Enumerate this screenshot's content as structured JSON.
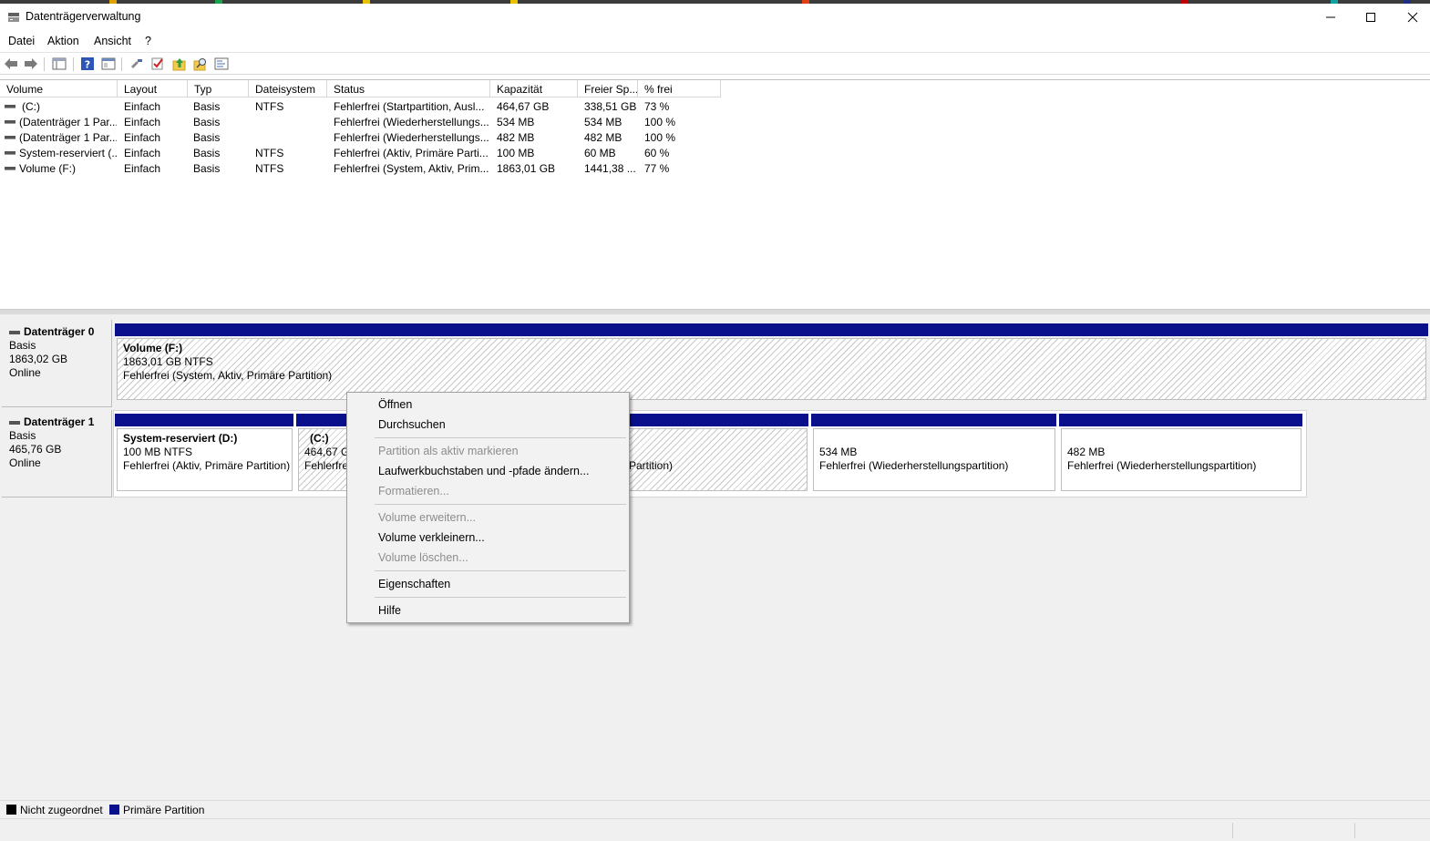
{
  "window": {
    "title": "Datenträgerverwaltung",
    "minimize_label": "Minimieren",
    "maximize_label": "Maximieren",
    "close_label": "Schließen"
  },
  "menubar": {
    "items": [
      {
        "label": "Datei"
      },
      {
        "label": "Aktion"
      },
      {
        "label": "Ansicht"
      },
      {
        "label": "?"
      }
    ]
  },
  "toolbar": {
    "icons": [
      "back-arrow-icon",
      "forward-arrow-icon",
      "volume-list-icon",
      "help-icon",
      "console-view-icon",
      "connect-icon",
      "check-icon",
      "folder-up-icon",
      "search-folder-icon",
      "properties-icon"
    ]
  },
  "volume_list": {
    "columns": [
      "Volume",
      "Layout",
      "Typ",
      "Dateisystem",
      "Status",
      "Kapazität",
      "Freier Sp...",
      "% frei"
    ],
    "rows": [
      {
        "volume": "(C:)",
        "layout": "Einfach",
        "typ": "Basis",
        "fs": "NTFS",
        "status": "Fehlerfrei (Startpartition, Ausl...",
        "capacity": "464,67 GB",
        "free": "338,51 GB",
        "pct": "73 %"
      },
      {
        "volume": "(Datenträger 1 Par...",
        "layout": "Einfach",
        "typ": "Basis",
        "fs": "",
        "status": "Fehlerfrei (Wiederherstellungs...",
        "capacity": "534 MB",
        "free": "534 MB",
        "pct": "100 %"
      },
      {
        "volume": "(Datenträger 1 Par...",
        "layout": "Einfach",
        "typ": "Basis",
        "fs": "",
        "status": "Fehlerfrei (Wiederherstellungs...",
        "capacity": "482 MB",
        "free": "482 MB",
        "pct": "100 %"
      },
      {
        "volume": "System-reserviert (...",
        "layout": "Einfach",
        "typ": "Basis",
        "fs": "NTFS",
        "status": "Fehlerfrei (Aktiv, Primäre Parti...",
        "capacity": "100 MB",
        "free": "60 MB",
        "pct": "60 %"
      },
      {
        "volume": "Volume (F:)",
        "layout": "Einfach",
        "typ": "Basis",
        "fs": "NTFS",
        "status": "Fehlerfrei (System, Aktiv, Prim...",
        "capacity": "1863,01 GB",
        "free": "1441,38 ...",
        "pct": "77 %"
      }
    ]
  },
  "disks": [
    {
      "name": "Datenträger 0",
      "type": "Basis",
      "size": "1863,02 GB",
      "state": "Online",
      "partitions": [
        {
          "name": "Volume  (F:)",
          "size_fs": "1863,01 GB NTFS",
          "status": "Fehlerfrei (System, Aktiv, Primäre Partition)"
        }
      ]
    },
    {
      "name": "Datenträger 1",
      "type": "Basis",
      "size": "465,76 GB",
      "state": "Online",
      "partitions": [
        {
          "name": "System-reserviert  (D:)",
          "size_fs": "100 MB NTFS",
          "status": "Fehlerfrei (Aktiv, Primäre Partition)"
        },
        {
          "name": "(C:)",
          "size_fs": "464,67 GB",
          "status": "Fehlerfrei",
          "status_tail": "Partition)"
        },
        {
          "name": "",
          "size_fs": "534 MB",
          "status": "Fehlerfrei (Wiederherstellungspartition)"
        },
        {
          "name": "",
          "size_fs": "482 MB",
          "status": "Fehlerfrei (Wiederherstellungspartition)"
        }
      ]
    }
  ],
  "legend": [
    {
      "label": "Nicht zugeordnet",
      "color": "#000000"
    },
    {
      "label": "Primäre Partition",
      "color": "#0a0f8c"
    }
  ],
  "context_menu": {
    "items": [
      {
        "label": "Öffnen",
        "enabled": true
      },
      {
        "label": "Durchsuchen",
        "enabled": true
      },
      {
        "label": "Partition als aktiv markieren",
        "enabled": false
      },
      {
        "label": "Laufwerkbuchstaben und -pfade ändern...",
        "enabled": true
      },
      {
        "label": "Formatieren...",
        "enabled": false
      },
      {
        "label": "Volume erweitern...",
        "enabled": false
      },
      {
        "label": "Volume verkleinern...",
        "enabled": true
      },
      {
        "label": "Volume löschen...",
        "enabled": false
      },
      {
        "label": "Eigenschaften",
        "enabled": true
      },
      {
        "label": "Hilfe",
        "enabled": true
      }
    ]
  },
  "colors": {
    "primary_partition": "#0a0f8c",
    "unallocated": "#000000"
  }
}
